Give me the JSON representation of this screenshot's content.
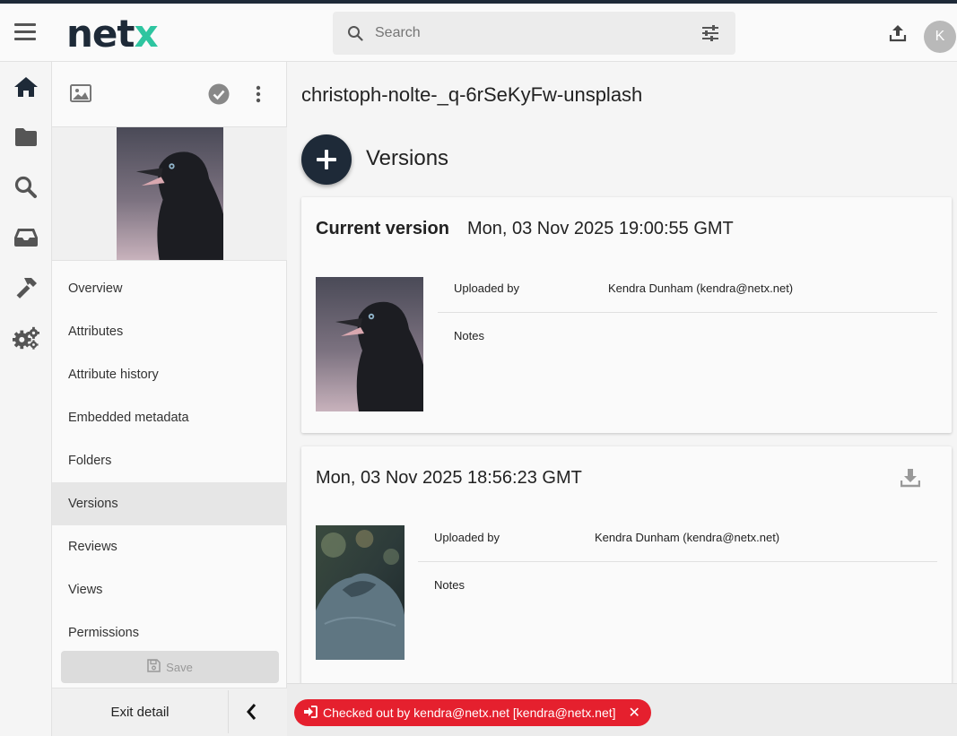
{
  "header": {
    "logo_main": "net",
    "logo_accent": "x",
    "search_placeholder": "Search",
    "avatar_initial": "K"
  },
  "rail": {
    "icons": [
      "home-icon",
      "folder-icon",
      "search-icon",
      "inbox-icon",
      "hammer-icon",
      "settings-icon"
    ]
  },
  "panel": {
    "nav": [
      {
        "label": "Overview"
      },
      {
        "label": "Attributes"
      },
      {
        "label": "Attribute history"
      },
      {
        "label": "Embedded metadata"
      },
      {
        "label": "Folders"
      },
      {
        "label": "Versions"
      },
      {
        "label": "Reviews"
      },
      {
        "label": "Views"
      },
      {
        "label": "Permissions"
      }
    ],
    "active_item": "Versions",
    "save_label": "Save",
    "exit_label": "Exit detail"
  },
  "main": {
    "asset_title": "christoph-nolte-_q-6rSeKyFw-unsplash",
    "versions_heading": "Versions",
    "current_version": {
      "label": "Current version",
      "date": "Mon, 03 Nov 2025 19:00:55 GMT",
      "uploaded_by_label": "Uploaded by",
      "uploaded_by": "Kendra Dunham (kendra@netx.net)",
      "notes_label": "Notes",
      "notes": ""
    },
    "previous_version": {
      "date": "Mon, 03 Nov 2025 18:56:23 GMT",
      "uploaded_by_label": "Uploaded by",
      "uploaded_by": "Kendra Dunham (kendra@netx.net)",
      "notes_label": "Notes",
      "notes": ""
    }
  },
  "footer": {
    "checkout_text": "Checked out by kendra@netx.net [kendra@netx.net]",
    "chip_color": "#e5202e"
  },
  "colors": {
    "brand_dark": "#1e2a38",
    "brand_accent": "#2ec5a0"
  }
}
